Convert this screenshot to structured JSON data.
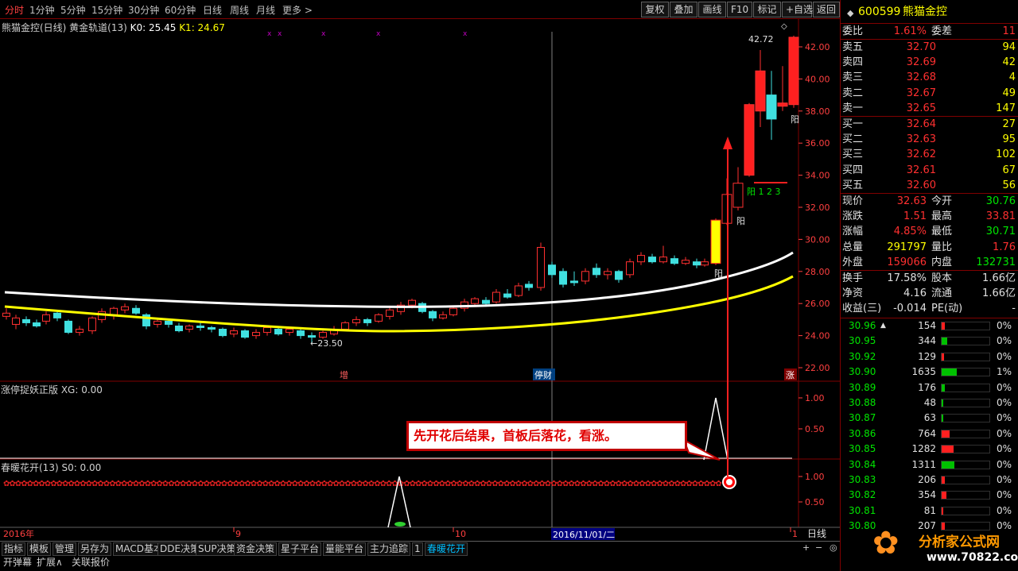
{
  "toolbar": {
    "periods": [
      "分时",
      "1分钟",
      "5分钟",
      "15分钟",
      "30分钟",
      "60分钟",
      "日线",
      "周线",
      "月线",
      "更多 >"
    ],
    "buttons": [
      "复权",
      "叠加",
      "画线",
      "F10",
      "标记",
      "+自选",
      "返回"
    ]
  },
  "main_chart": {
    "title": "熊猫金控(日线) 黄金轨道(13)",
    "k0": "K0: 25.45",
    "k1": "K1: 24.67",
    "y_ticks": [
      "42.00",
      "40.00",
      "38.00",
      "36.00",
      "34.00",
      "32.00",
      "30.00",
      "28.00",
      "26.00",
      "24.00",
      "22.00"
    ],
    "high_label": "42.72",
    "low_label": "←23.50",
    "markers": [
      "增",
      "停财",
      "涨"
    ],
    "yang_labels": [
      "阳",
      "阳",
      "阳",
      "阳 1 2 3"
    ],
    "cursor_date": "2016/11/01/二"
  },
  "ind1": {
    "title": "涨停捉妖正版 XG: 0.00",
    "y_ticks": [
      "1.00",
      "0.50"
    ]
  },
  "ind2": {
    "title": "春暖花开(13) S0: 0.00",
    "y_ticks": [
      "1.00",
      "0.50"
    ]
  },
  "annotation": "先开花后结果，首板后落花，看涨。",
  "x_axis": {
    "labels": [
      "2016年",
      "9",
      "10",
      "1"
    ],
    "period": "日线"
  },
  "bottom_tabs": [
    "指标",
    "模板",
    "管理",
    "另存为",
    "MACD基本",
    "DDE决策",
    "SUP决策",
    "资金决策",
    "星子平台",
    "量能平台",
    "主力追踪",
    "1",
    "春暖花开"
  ],
  "bottom_tabs2": [
    "开弹幕",
    "扩展∧",
    "关联报价"
  ],
  "stock": {
    "code": "600599",
    "name": "熊猫金控"
  },
  "quote": {
    "weibi": "1.61%",
    "weicha": "11",
    "sells": [
      {
        "label": "卖五",
        "price": "32.70",
        "vol": "94"
      },
      {
        "label": "卖四",
        "price": "32.69",
        "vol": "42"
      },
      {
        "label": "卖三",
        "price": "32.68",
        "vol": "4"
      },
      {
        "label": "卖二",
        "price": "32.67",
        "vol": "49"
      },
      {
        "label": "卖一",
        "price": "32.65",
        "vol": "147"
      }
    ],
    "buys": [
      {
        "label": "买一",
        "price": "32.64",
        "vol": "27"
      },
      {
        "label": "买二",
        "price": "32.63",
        "vol": "95"
      },
      {
        "label": "买三",
        "price": "32.62",
        "vol": "102"
      },
      {
        "label": "买四",
        "price": "32.61",
        "vol": "67"
      },
      {
        "label": "买五",
        "price": "32.60",
        "vol": "56"
      }
    ],
    "stats": [
      {
        "l1": "现价",
        "v1": "32.63",
        "l2": "今开",
        "v2": "30.76",
        "c1": "red",
        "c2": "grn"
      },
      {
        "l1": "涨跌",
        "v1": "1.51",
        "l2": "最高",
        "v2": "33.81",
        "c1": "red",
        "c2": "red"
      },
      {
        "l1": "涨幅",
        "v1": "4.85%",
        "l2": "最低",
        "v2": "30.71",
        "c1": "red",
        "c2": "grn"
      },
      {
        "l1": "总量",
        "v1": "291797",
        "l2": "量比",
        "v2": "1.76",
        "c1": "yel",
        "c2": "red"
      },
      {
        "l1": "外盘",
        "v1": "159066",
        "l2": "内盘",
        "v2": "132731",
        "c1": "red",
        "c2": "grn"
      }
    ],
    "stats2": [
      {
        "l1": "换手",
        "v1": "17.58%",
        "l2": "股本",
        "v2": "1.66亿"
      },
      {
        "l1": "净资",
        "v1": "4.16",
        "l2": "流通",
        "v2": "1.66亿"
      },
      {
        "l1": "收益(三)",
        "v1": "-0.014",
        "l2": "PE(动)",
        "v2": "-"
      }
    ]
  },
  "ticks": [
    {
      "price": "30.96",
      "arrow": "▲",
      "vol": "154",
      "pct": "0%",
      "bar": 0.05,
      "c": "red"
    },
    {
      "price": "30.95",
      "arrow": "",
      "vol": "344",
      "pct": "0%",
      "bar": 0.1,
      "c": "grn"
    },
    {
      "price": "30.92",
      "arrow": "",
      "vol": "129",
      "pct": "0%",
      "bar": 0.04,
      "c": "red"
    },
    {
      "price": "30.90",
      "arrow": "",
      "vol": "1635",
      "pct": "1%",
      "bar": 0.3,
      "c": "grn"
    },
    {
      "price": "30.89",
      "arrow": "",
      "vol": "176",
      "pct": "0%",
      "bar": 0.05,
      "c": "grn"
    },
    {
      "price": "30.88",
      "arrow": "",
      "vol": "48",
      "pct": "0%",
      "bar": 0.02,
      "c": "grn"
    },
    {
      "price": "30.87",
      "arrow": "",
      "vol": "63",
      "pct": "0%",
      "bar": 0.02,
      "c": "grn"
    },
    {
      "price": "30.86",
      "arrow": "",
      "vol": "764",
      "pct": "0%",
      "bar": 0.15,
      "c": "red"
    },
    {
      "price": "30.85",
      "arrow": "",
      "vol": "1282",
      "pct": "0%",
      "bar": 0.24,
      "c": "red"
    },
    {
      "price": "30.84",
      "arrow": "",
      "vol": "1311",
      "pct": "0%",
      "bar": 0.25,
      "c": "grn"
    },
    {
      "price": "30.83",
      "arrow": "",
      "vol": "206",
      "pct": "0%",
      "bar": 0.05,
      "c": "red"
    },
    {
      "price": "30.82",
      "arrow": "",
      "vol": "354",
      "pct": "0%",
      "bar": 0.08,
      "c": "red"
    },
    {
      "price": "30.81",
      "arrow": "",
      "vol": "81",
      "pct": "0%",
      "bar": 0.02,
      "c": "red"
    },
    {
      "price": "30.80",
      "arrow": "",
      "vol": "207",
      "pct": "0%",
      "bar": 0.05,
      "c": "red"
    }
  ],
  "watermark": {
    "brand": "分析家公式网",
    "url": "www.70822.com"
  }
}
